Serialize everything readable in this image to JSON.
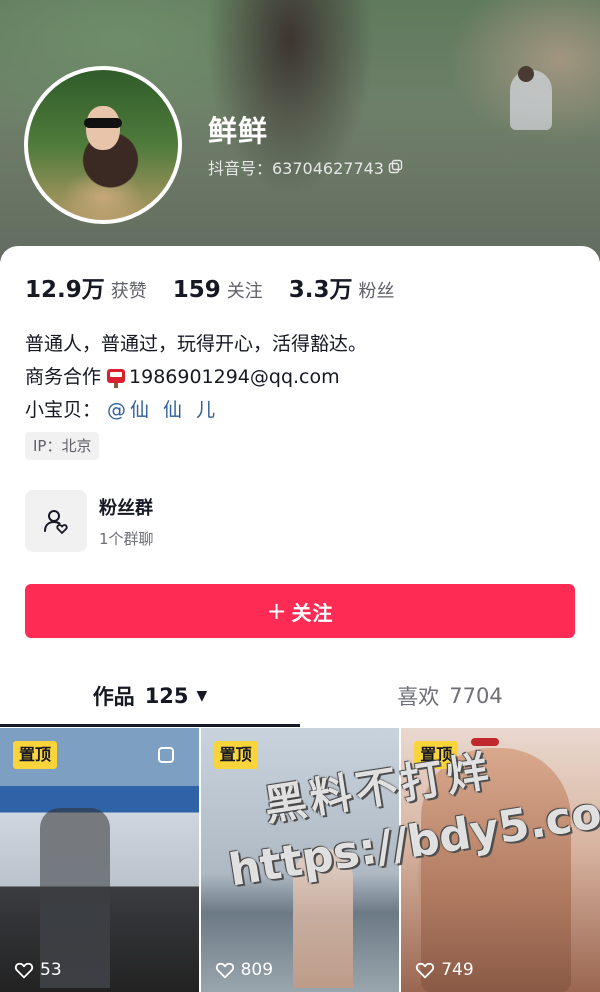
{
  "profile": {
    "username": "鲜鲜",
    "douyin_id": "抖音号：63704627743"
  },
  "stats": [
    {
      "value": "12.9万",
      "label": "获赞"
    },
    {
      "value": "159",
      "label": "关注"
    },
    {
      "value": "3.3万",
      "label": "粉丝"
    }
  ],
  "bio": {
    "line1": "普通人，普通过，玩得开心，活得豁达。",
    "line2_prefix": "商务合作",
    "line2_email": "1986901294@qq.com",
    "line3_prefix": "小宝贝：",
    "line3_mention": "@仙 仙 儿"
  },
  "ip_tag": "IP：北京",
  "fan_group": {
    "title": "粉丝群",
    "subtitle": "1个群聊"
  },
  "follow_button": {
    "plus": "+",
    "label": "关注"
  },
  "tabs": {
    "works_label": "作品",
    "works_count": "125",
    "likes_label": "喜欢",
    "likes_count": "7704"
  },
  "grid": [
    {
      "badge": "置顶",
      "likes": "53"
    },
    {
      "badge": "置顶",
      "likes": "809"
    },
    {
      "badge": "置顶",
      "likes": "749"
    }
  ],
  "watermark": {
    "line1": "黑料不打烊",
    "line2": "https://bdy5.co"
  },
  "colors": {
    "accent": "#fe2c55",
    "pin_badge": "#f9d43a",
    "mention": "#2e5f9a"
  },
  "icons": {
    "copy": "copy-icon",
    "mailbox": "mailbox-icon",
    "fan_group": "fan-group-icon",
    "heart": "heart-icon",
    "dropdown": "caret-down-icon"
  }
}
